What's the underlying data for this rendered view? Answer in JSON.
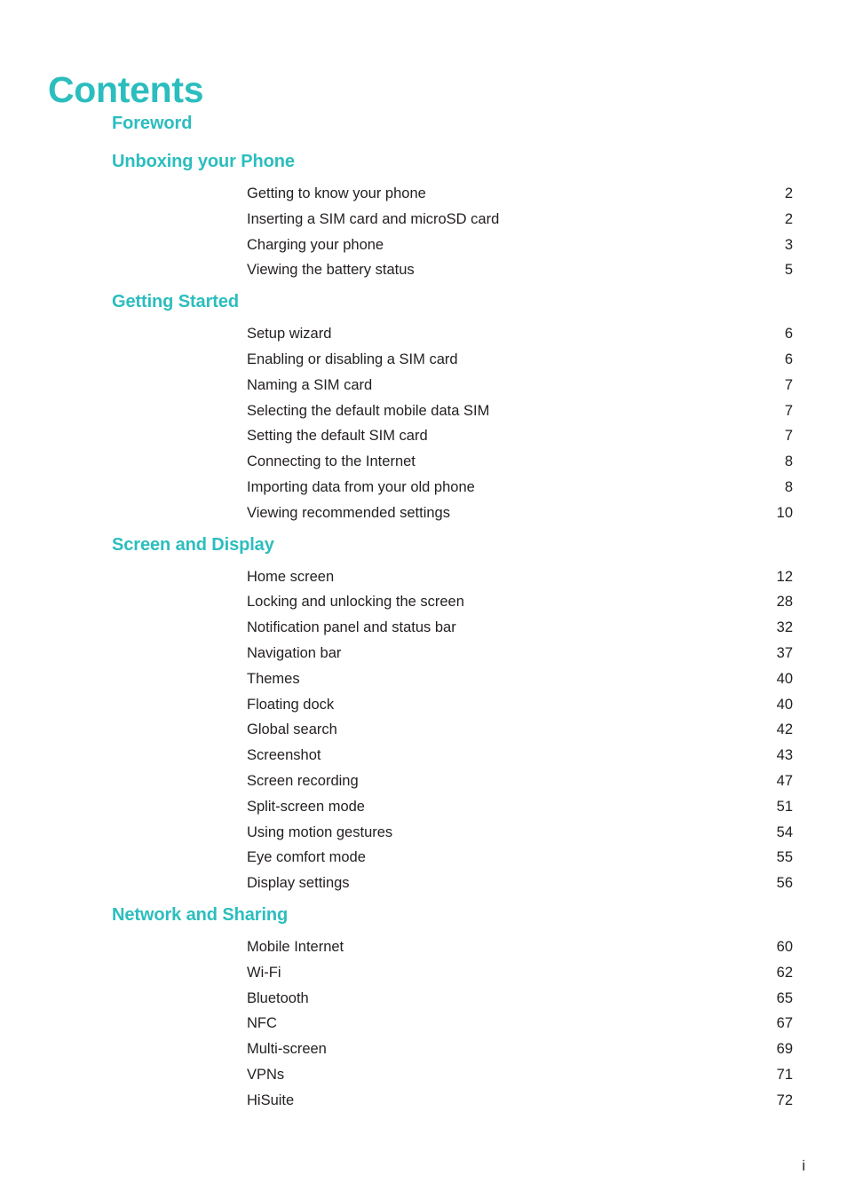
{
  "document": {
    "title": "Contents",
    "folio": "i",
    "accent_color": "#2CBDBE",
    "text_color": "#231f20"
  },
  "sections": [
    {
      "title": "Foreword",
      "entries": []
    },
    {
      "title": "Unboxing your Phone",
      "entries": [
        {
          "label": "Getting to know your phone",
          "page": "2"
        },
        {
          "label": "Inserting a SIM card and microSD card",
          "page": "2"
        },
        {
          "label": "Charging your phone",
          "page": "3"
        },
        {
          "label": "Viewing the battery status",
          "page": "5"
        }
      ]
    },
    {
      "title": "Getting Started",
      "entries": [
        {
          "label": "Setup wizard",
          "page": "6"
        },
        {
          "label": "Enabling or disabling a SIM card",
          "page": "6"
        },
        {
          "label": "Naming a SIM card",
          "page": "7"
        },
        {
          "label": "Selecting the default mobile data SIM",
          "page": "7"
        },
        {
          "label": "Setting the default SIM card",
          "page": "7"
        },
        {
          "label": "Connecting to the Internet",
          "page": "8"
        },
        {
          "label": "Importing data from your old phone",
          "page": "8"
        },
        {
          "label": "Viewing recommended settings",
          "page": "10"
        }
      ]
    },
    {
      "title": "Screen and Display",
      "entries": [
        {
          "label": "Home screen",
          "page": "12"
        },
        {
          "label": "Locking and unlocking the screen",
          "page": "28"
        },
        {
          "label": "Notification panel and status bar",
          "page": "32"
        },
        {
          "label": "Navigation bar",
          "page": "37"
        },
        {
          "label": "Themes",
          "page": "40"
        },
        {
          "label": "Floating dock",
          "page": "40"
        },
        {
          "label": "Global search",
          "page": "42"
        },
        {
          "label": "Screenshot",
          "page": "43"
        },
        {
          "label": "Screen recording",
          "page": "47"
        },
        {
          "label": "Split-screen mode",
          "page": "51"
        },
        {
          "label": "Using motion gestures",
          "page": "54"
        },
        {
          "label": "Eye comfort mode",
          "page": "55"
        },
        {
          "label": "Display settings",
          "page": "56"
        }
      ]
    },
    {
      "title": "Network and Sharing",
      "entries": [
        {
          "label": "Mobile Internet",
          "page": "60"
        },
        {
          "label": "Wi-Fi",
          "page": "62"
        },
        {
          "label": "Bluetooth",
          "page": "65"
        },
        {
          "label": "NFC",
          "page": "67"
        },
        {
          "label": "Multi-screen",
          "page": "69"
        },
        {
          "label": "VPNs",
          "page": "71"
        },
        {
          "label": "HiSuite",
          "page": "72"
        }
      ]
    }
  ]
}
